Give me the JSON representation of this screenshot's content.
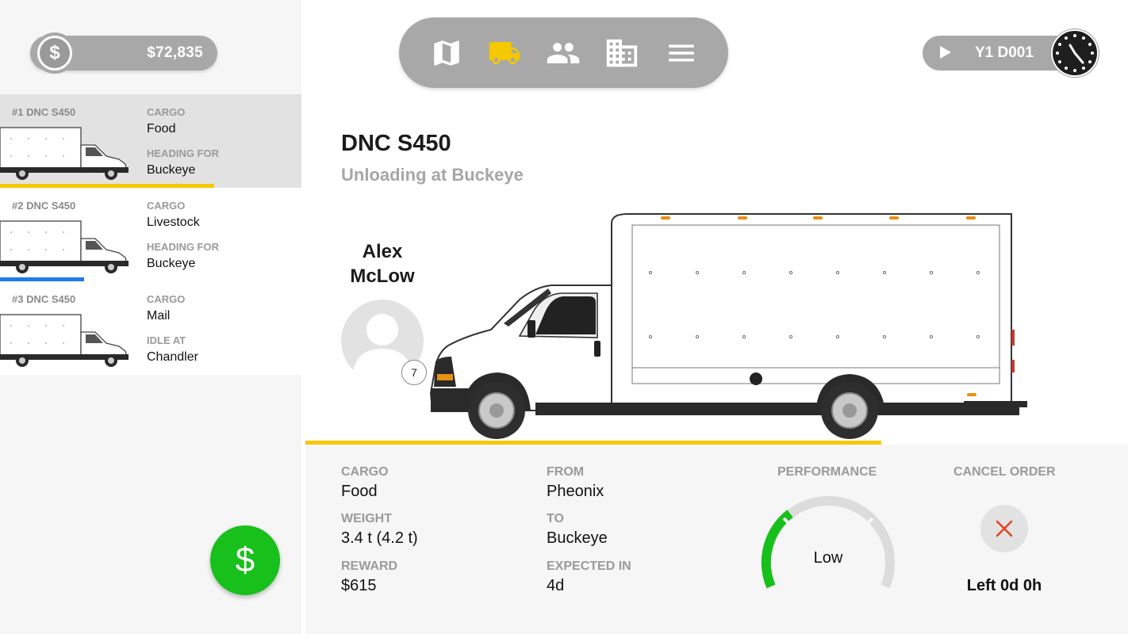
{
  "money": {
    "value": "$72,835",
    "icon": "dollar-coin-icon"
  },
  "nav": {
    "items": [
      {
        "icon": "map-icon",
        "active": false
      },
      {
        "icon": "truck-icon",
        "active": true
      },
      {
        "icon": "people-icon",
        "active": false
      },
      {
        "icon": "building-icon",
        "active": false
      },
      {
        "icon": "menu-icon",
        "active": false
      }
    ],
    "active_color": "#f5c800"
  },
  "time": {
    "value": "Y1 D001",
    "icons": [
      "play-icon",
      "clock-icon"
    ]
  },
  "trucks": [
    {
      "name": "#1 DNC S450",
      "cargo_label": "CARGO",
      "cargo": "Food",
      "dest_label": "HEADING FOR",
      "dest": "Buckeye",
      "progress": 0.71,
      "bar_color": "#f5c800",
      "selected": true
    },
    {
      "name": "#2 DNC S450",
      "cargo_label": "CARGO",
      "cargo": "Livestock",
      "dest_label": "HEADING FOR",
      "dest": "Buckeye",
      "progress": 0.28,
      "bar_color": "#1e7bea",
      "selected": false
    },
    {
      "name": "#3 DNC S450",
      "cargo_label": "CARGO",
      "cargo": "Mail",
      "dest_label": "IDLE AT",
      "dest": "Chandler",
      "progress": 0,
      "bar_color": "#1e7bea",
      "selected": false
    }
  ],
  "cash_button": {
    "label": "$",
    "color": "#17c01a"
  },
  "detail": {
    "title": "DNC S450",
    "status": "Unloading at Buckeye",
    "driver": {
      "name": "Alex McLow",
      "level": "7"
    },
    "progress": 0.7,
    "info": {
      "cargo_label": "CARGO",
      "cargo": "Food",
      "weight_label": "WEIGHT",
      "weight": "3.4 t (4.2 t)",
      "reward_label": "REWARD",
      "reward": "$615",
      "from_label": "FROM",
      "from": "Pheonix",
      "to_label": "TO",
      "to": "Buckeye",
      "expected_label": "EXPECTED IN",
      "expected": "4d",
      "performance_label": "PERFORMANCE",
      "performance": "Low",
      "performance_level": 0.3,
      "cancel_label": "CANCEL ORDER",
      "cancel_time": "Left 0d 0h"
    }
  }
}
